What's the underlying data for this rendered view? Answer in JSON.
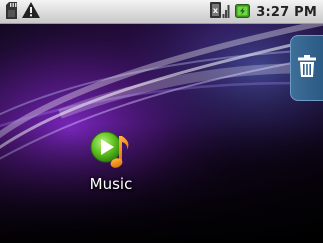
{
  "status_bar": {
    "time": "3:27 PM",
    "icons": [
      "sd-card-icon",
      "warning-icon",
      "no-sim-signal-icon",
      "battery-charging-icon"
    ]
  },
  "home": {
    "apps": [
      {
        "label": "Music",
        "icon": "music-icon"
      }
    ],
    "trash": {
      "icon": "trash-icon"
    }
  },
  "colors": {
    "trash_tab": "#2f5f8a",
    "battery_green": "#4fb52a",
    "wallpaper_purple": "#5a1a8c"
  }
}
